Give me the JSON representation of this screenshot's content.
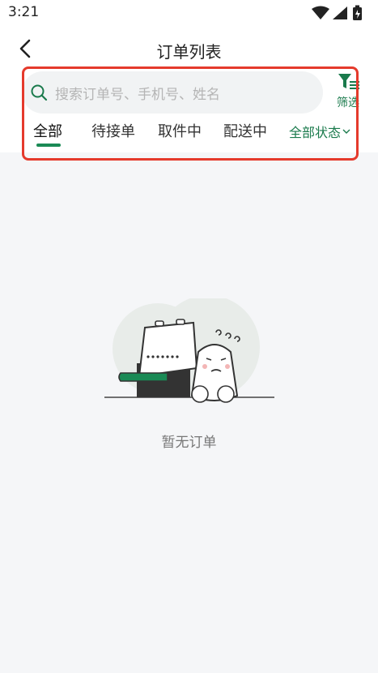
{
  "status_bar": {
    "time": "3:21"
  },
  "header": {
    "title": "订单列表"
  },
  "search": {
    "placeholder": "搜索订单号、手机号、姓名"
  },
  "filter": {
    "label": "筛选"
  },
  "tabs": [
    {
      "label": "全部",
      "active": true
    },
    {
      "label": "待接单",
      "active": false
    },
    {
      "label": "取件中",
      "active": false
    },
    {
      "label": "配送中",
      "active": false
    }
  ],
  "status_filter": {
    "label": "全部状态"
  },
  "empty_state": {
    "message": "暂无订单"
  },
  "colors": {
    "accent": "#1a8a55",
    "highlight": "#e53a2c",
    "background": "#f5f6f8"
  },
  "icons": [
    "back-icon",
    "search-icon",
    "filter-icon",
    "chevron-down-icon",
    "wifi-icon",
    "signal-icon",
    "battery-icon"
  ]
}
